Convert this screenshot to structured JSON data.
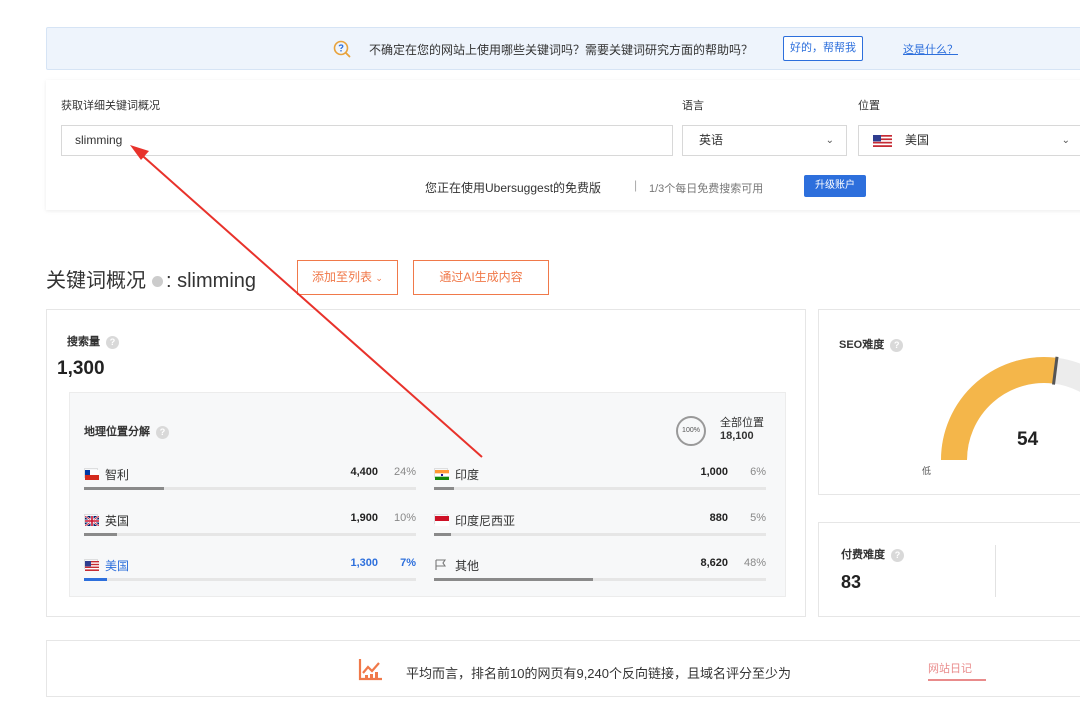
{
  "banner": {
    "message": "不确定在您的网站上使用哪些关键词吗？需要关键词研究方面的帮助吗？",
    "help_button": "好的，帮帮我",
    "what_link": "这是什么？"
  },
  "search": {
    "keyword_label": "获取详细关键词概况",
    "keyword_value": "slimming",
    "language_label": "语言",
    "language_value": "英语",
    "location_label": "位置",
    "location_value": "美国",
    "free_text": "您正在使用Ubersuggest的免费版",
    "free_sep": "|",
    "free_count": "1/3个每日免费搜索可用",
    "upgrade_button": "升级账户"
  },
  "overview": {
    "title_prefix": "关键词概况",
    "title_keyword": ": slimming",
    "add_to_list": "添加至列表",
    "ai_button": "通过AI生成内容"
  },
  "volume": {
    "label": "搜索量",
    "value": "1,300",
    "geo_title": "地理位置分解",
    "ring_text": "100%",
    "all_label": "全部位置",
    "all_count": "18,100",
    "countries": [
      {
        "name": "智利",
        "value": "4,400",
        "pct": "24%",
        "fill": 24,
        "flag": "cl"
      },
      {
        "name": "印度",
        "value": "1,000",
        "pct": "6%",
        "fill": 6,
        "flag": "in"
      },
      {
        "name": "英国",
        "value": "1,900",
        "pct": "10%",
        "fill": 10,
        "flag": "gb"
      },
      {
        "name": "印度尼西亚",
        "value": "880",
        "pct": "5%",
        "fill": 5,
        "flag": "id"
      },
      {
        "name": "美国",
        "value": "1,300",
        "pct": "7%",
        "fill": 7,
        "flag": "us"
      },
      {
        "name": "其他",
        "value": "8,620",
        "pct": "48%",
        "fill": 48,
        "flag": "other"
      }
    ]
  },
  "seo": {
    "label": "SEO难度",
    "value": "54",
    "difficulty": 54,
    "low_label": "低"
  },
  "paid": {
    "label": "付费难度",
    "value": "83"
  },
  "backlink": {
    "text": "平均而言，排名前10的网页有9,240个反向链接，且域名评分至少为",
    "watermark": "网站日记"
  },
  "colors": {
    "primary": "#2d6fdc",
    "orange": "#f0794a",
    "gauge": "#f4b64a",
    "annotation": "#e8322b"
  }
}
